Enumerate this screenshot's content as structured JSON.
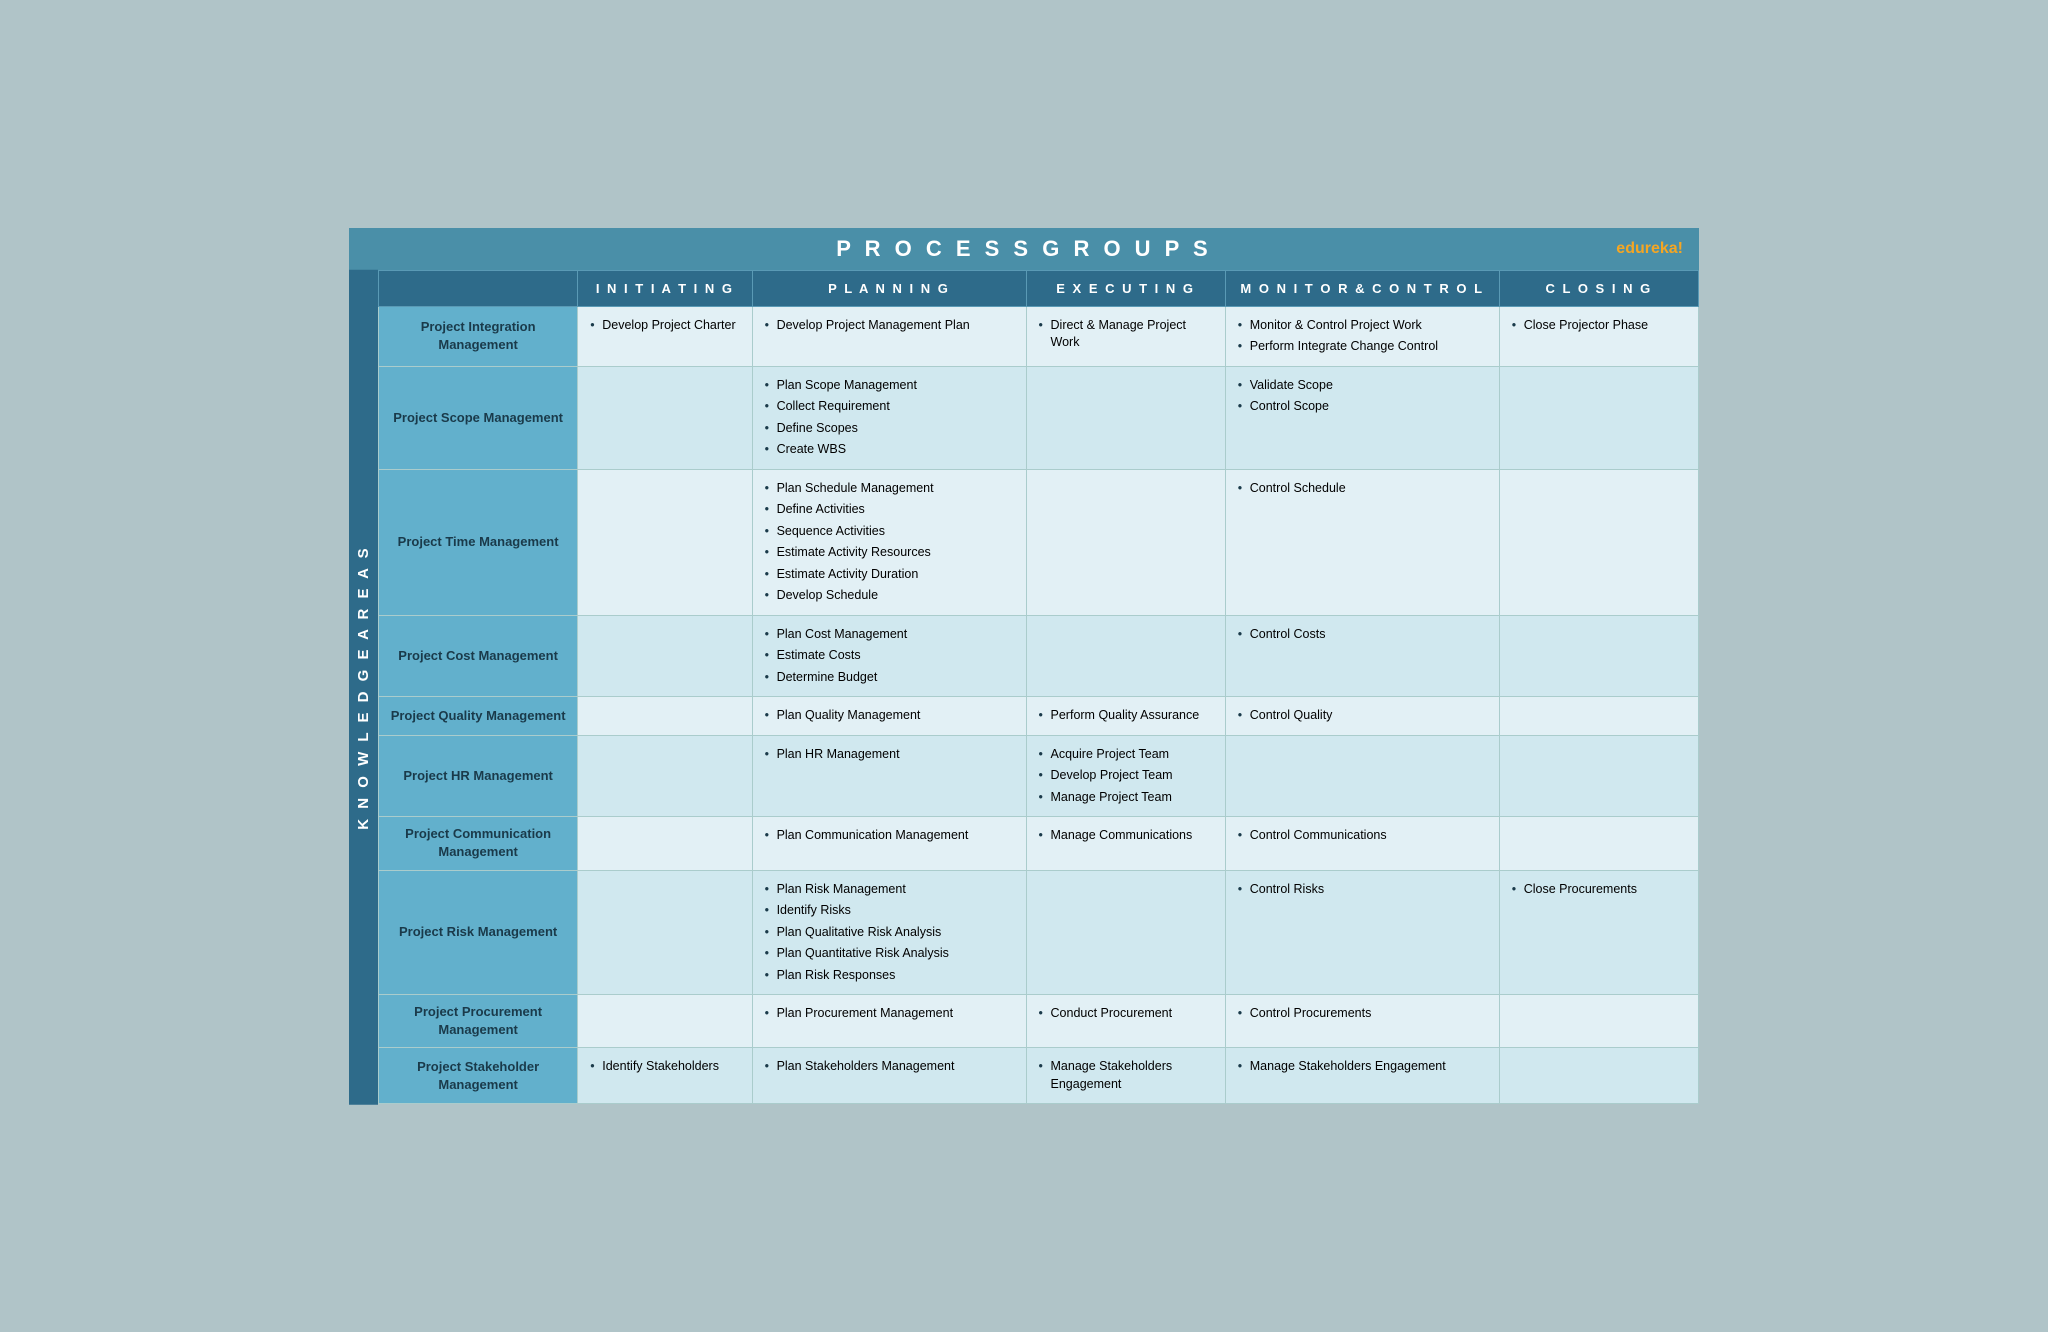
{
  "header": {
    "title": "P R O C E S S   G R O U P S",
    "brand": "edureka!"
  },
  "columns": {
    "rowHeader": "",
    "initiating": "I N I T I A T I N G",
    "planning": "P L A N N I N G",
    "executing": "E X E C U T I N G",
    "monitor": "M O N I T O R  &  C O N T R O L",
    "closing": "C L O S I N G"
  },
  "knowledgeAreasLabel": "K N O W L E D G E   A R E A S",
  "rows": [
    {
      "header": "Project Integration Management",
      "initiating": [
        "Develop Project Charter"
      ],
      "planning": [
        "Develop Project Management Plan"
      ],
      "executing": [
        "Direct & Manage Project Work"
      ],
      "monitor": [
        "Monitor & Control Project Work",
        "Perform Integrate Change Control"
      ],
      "closing": [
        "Close Projector Phase"
      ]
    },
    {
      "header": "Project Scope Management",
      "initiating": [],
      "planning": [
        "Plan Scope Management",
        "Collect Requirement",
        "Define Scopes",
        "Create WBS"
      ],
      "executing": [],
      "monitor": [
        "Validate Scope",
        "Control Scope"
      ],
      "closing": []
    },
    {
      "header": "Project Time Management",
      "initiating": [],
      "planning": [
        "Plan Schedule Management",
        "Define Activities",
        "Sequence Activities",
        "Estimate Activity Resources",
        "Estimate Activity Duration",
        "Develop Schedule"
      ],
      "executing": [],
      "monitor": [
        "Control Schedule"
      ],
      "closing": []
    },
    {
      "header": "Project Cost Management",
      "initiating": [],
      "planning": [
        "Plan Cost Management",
        "Estimate Costs",
        "Determine Budget"
      ],
      "executing": [],
      "monitor": [
        "Control Costs"
      ],
      "closing": []
    },
    {
      "header": "Project Quality Management",
      "initiating": [],
      "planning": [
        "Plan Quality Management"
      ],
      "executing": [
        "Perform Quality Assurance"
      ],
      "monitor": [
        "Control Quality"
      ],
      "closing": []
    },
    {
      "header": "Project HR Management",
      "initiating": [],
      "planning": [
        "Plan HR Management"
      ],
      "executing": [
        "Acquire Project Team",
        "Develop Project Team",
        "Manage Project Team"
      ],
      "monitor": [],
      "closing": []
    },
    {
      "header": "Project Communication Management",
      "initiating": [],
      "planning": [
        "Plan Communication Management"
      ],
      "executing": [
        "Manage Communications"
      ],
      "monitor": [
        "Control Communications"
      ],
      "closing": []
    },
    {
      "header": "Project Risk Management",
      "initiating": [],
      "planning": [
        "Plan Risk Management",
        "Identify Risks",
        "Plan Qualitative Risk Analysis",
        "Plan Quantitative Risk Analysis",
        "Plan Risk Responses"
      ],
      "executing": [],
      "monitor": [
        "Control Risks"
      ],
      "closing": [
        "Close Procurements"
      ]
    },
    {
      "header": "Project Procurement Management",
      "initiating": [],
      "planning": [
        "Plan Procurement Management"
      ],
      "executing": [
        "Conduct Procurement"
      ],
      "monitor": [
        "Control Procurements"
      ],
      "closing": []
    },
    {
      "header": "Project Stakeholder Management",
      "initiating": [
        "Identify Stakeholders"
      ],
      "planning": [
        "Plan Stakeholders Management"
      ],
      "executing": [
        "Manage Stakeholders Engagement"
      ],
      "monitor": [
        "Manage Stakeholders Engagement"
      ],
      "closing": []
    }
  ]
}
